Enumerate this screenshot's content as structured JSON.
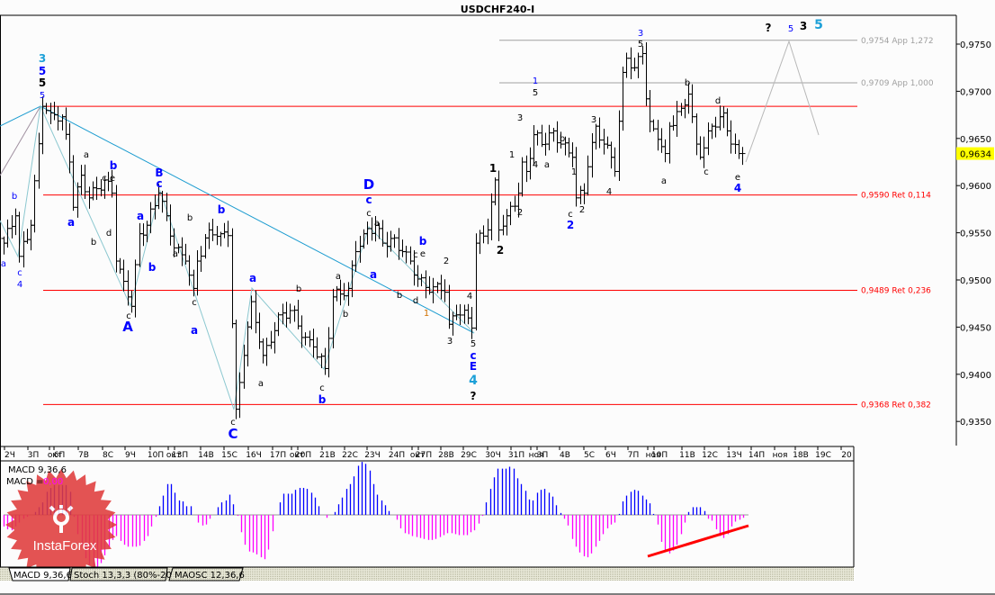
{
  "title": "USDCHF240-I",
  "chart_data": {
    "type": "ohlc",
    "symbol": "USDCHF240-I",
    "timeframe": "H4",
    "y_axis": {
      "range": [
        0.9325,
        0.978
      ],
      "ticks": [
        {
          "value": 0.975,
          "label": "0,9750"
        },
        {
          "value": 0.97,
          "label": "0,9700"
        },
        {
          "value": 0.965,
          "label": "0,9650"
        },
        {
          "value": 0.96,
          "label": "0,9600"
        },
        {
          "value": 0.955,
          "label": "0,9550"
        },
        {
          "value": 0.95,
          "label": "0,9500"
        },
        {
          "value": 0.945,
          "label": "0,9450"
        },
        {
          "value": 0.94,
          "label": "0,9400"
        },
        {
          "value": 0.935,
          "label": "0,9350"
        }
      ]
    },
    "x_axis": {
      "ticks": [
        "2Ч",
        "3П",
        "окт",
        "6П",
        "7В",
        "8С",
        "9Ч",
        "10П",
        "окт",
        "13П",
        "14В",
        "15С",
        "16Ч",
        "17П",
        "окт",
        "20П",
        "21В",
        "22С",
        "23Ч",
        "24П",
        "окт",
        "27П",
        "28В",
        "29С",
        "30Ч",
        "31П",
        "ноя",
        "3П",
        "4В",
        "5С",
        "6Ч",
        "7П",
        "ноя",
        "10П",
        "11В",
        "12С",
        "13Ч",
        "14П",
        "ноя",
        "18В",
        "19С",
        "20"
      ]
    },
    "current_price": {
      "value": 0.9634,
      "label": "0,9634",
      "color": "#ffff00"
    },
    "price_path": [
      {
        "bar": 0,
        "price": 0.9539
      },
      {
        "bar": 3,
        "price": 0.9568
      },
      {
        "bar": 4,
        "price": 0.9525
      },
      {
        "bar": 7,
        "price": 0.9558
      },
      {
        "bar": 10,
        "price": 0.9684
      },
      {
        "bar": 12,
        "price": 0.9677
      },
      {
        "bar": 15,
        "price": 0.9673
      },
      {
        "bar": 17,
        "price": 0.9625
      },
      {
        "bar": 18,
        "price": 0.9577
      },
      {
        "bar": 20,
        "price": 0.9611
      },
      {
        "bar": 22,
        "price": 0.9587
      },
      {
        "bar": 26,
        "price": 0.9606
      },
      {
        "bar": 28,
        "price": 0.9592
      },
      {
        "bar": 29,
        "price": 0.952
      },
      {
        "bar": 32,
        "price": 0.9482
      },
      {
        "bar": 33,
        "price": 0.9472
      },
      {
        "bar": 35,
        "price": 0.9549
      },
      {
        "bar": 37,
        "price": 0.9558
      },
      {
        "bar": 40,
        "price": 0.9592
      },
      {
        "bar": 42,
        "price": 0.9568
      },
      {
        "bar": 44,
        "price": 0.9534
      },
      {
        "bar": 47,
        "price": 0.952
      },
      {
        "bar": 49,
        "price": 0.9491
      },
      {
        "bar": 50,
        "price": 0.952
      },
      {
        "bar": 53,
        "price": 0.9553
      },
      {
        "bar": 56,
        "price": 0.9549
      },
      {
        "bar": 58,
        "price": 0.9547
      },
      {
        "bar": 60,
        "price": 0.9363
      },
      {
        "bar": 62,
        "price": 0.942
      },
      {
        "bar": 64,
        "price": 0.9477
      },
      {
        "bar": 67,
        "price": 0.942
      },
      {
        "bar": 69,
        "price": 0.9434
      },
      {
        "bar": 71,
        "price": 0.9463
      },
      {
        "bar": 75,
        "price": 0.9468
      },
      {
        "bar": 77,
        "price": 0.9439
      },
      {
        "bar": 80,
        "price": 0.9429
      },
      {
        "bar": 83,
        "price": 0.9406
      },
      {
        "bar": 85,
        "price": 0.9482
      },
      {
        "bar": 89,
        "price": 0.9491
      },
      {
        "bar": 91,
        "price": 0.953
      },
      {
        "bar": 93,
        "price": 0.9549
      },
      {
        "bar": 96,
        "price": 0.9558
      },
      {
        "bar": 98,
        "price": 0.9539
      },
      {
        "bar": 100,
        "price": 0.9544
      },
      {
        "bar": 103,
        "price": 0.953
      },
      {
        "bar": 105,
        "price": 0.952
      },
      {
        "bar": 107,
        "price": 0.9501
      },
      {
        "bar": 110,
        "price": 0.9487
      },
      {
        "bar": 112,
        "price": 0.9496
      },
      {
        "bar": 114,
        "price": 0.9487
      },
      {
        "bar": 115,
        "price": 0.9453
      },
      {
        "bar": 117,
        "price": 0.9463
      },
      {
        "bar": 119,
        "price": 0.9468
      },
      {
        "bar": 121,
        "price": 0.9449
      },
      {
        "bar": 122,
        "price": 0.9539
      },
      {
        "bar": 125,
        "price": 0.9553
      },
      {
        "bar": 127,
        "price": 0.9606
      },
      {
        "bar": 128,
        "price": 0.9553
      },
      {
        "bar": 130,
        "price": 0.9568
      },
      {
        "bar": 133,
        "price": 0.9592
      },
      {
        "bar": 134,
        "price": 0.9625
      },
      {
        "bar": 135,
        "price": 0.9615
      },
      {
        "bar": 137,
        "price": 0.9654
      },
      {
        "bar": 140,
        "price": 0.9644
      },
      {
        "bar": 142,
        "price": 0.9658
      },
      {
        "bar": 144,
        "price": 0.9644
      },
      {
        "bar": 147,
        "price": 0.963
      },
      {
        "bar": 148,
        "price": 0.9587
      },
      {
        "bar": 150,
        "price": 0.9592
      },
      {
        "bar": 151,
        "price": 0.962
      },
      {
        "bar": 153,
        "price": 0.9663
      },
      {
        "bar": 155,
        "price": 0.9644
      },
      {
        "bar": 157,
        "price": 0.963
      },
      {
        "bar": 158,
        "price": 0.9615
      },
      {
        "bar": 160,
        "price": 0.972
      },
      {
        "bar": 161,
        "price": 0.9735
      },
      {
        "bar": 163,
        "price": 0.9725
      },
      {
        "bar": 165,
        "price": 0.974
      },
      {
        "bar": 166,
        "price": 0.9692
      },
      {
        "bar": 167,
        "price": 0.9668
      },
      {
        "bar": 169,
        "price": 0.9649
      },
      {
        "bar": 171,
        "price": 0.9634
      },
      {
        "bar": 172,
        "price": 0.9663
      },
      {
        "bar": 175,
        "price": 0.9682
      },
      {
        "bar": 177,
        "price": 0.9697
      },
      {
        "bar": 178,
        "price": 0.9673
      },
      {
        "bar": 179,
        "price": 0.9644
      },
      {
        "bar": 180,
        "price": 0.963
      },
      {
        "bar": 183,
        "price": 0.9663
      },
      {
        "bar": 185,
        "price": 0.9673
      },
      {
        "bar": 186,
        "price": 0.9677
      },
      {
        "bar": 187,
        "price": 0.9658
      },
      {
        "bar": 188,
        "price": 0.9644
      },
      {
        "bar": 190,
        "price": 0.9634
      },
      {
        "bar": 191,
        "price": 0.9634
      }
    ],
    "levels": [
      {
        "price": 0.9754,
        "label": "0,9754 App 1,272",
        "color": "#a0a0a0"
      },
      {
        "price": 0.9709,
        "label": "0,9709 App 1,000",
        "color": "#a0a0a0"
      },
      {
        "price": 0.9684,
        "label": "",
        "color": "#ff0000"
      },
      {
        "price": 0.959,
        "label": "0,9590 Ret 0,114",
        "color": "#ff0000"
      },
      {
        "price": 0.9489,
        "label": "0,9489 Ret 0,236",
        "color": "#ff0000"
      },
      {
        "price": 0.9368,
        "label": "0,9368 Ret 0,382",
        "color": "#ff0000"
      }
    ],
    "trendline_color": "#1c9cd0",
    "wave_line_color": "#8cc8d0",
    "wave_labels": [
      {
        "text": "3",
        "color": "#1ca0d8"
      },
      {
        "text": "5",
        "color": "#0000ff"
      },
      {
        "text": "5",
        "color": "#000000"
      },
      {
        "text": "5",
        "color": "#0000ff"
      },
      {
        "text": "b",
        "color": "#0000ff"
      },
      {
        "text": "a",
        "color": "#0000ff"
      },
      {
        "text": "c",
        "color": "#0000ff"
      },
      {
        "text": "4",
        "color": "#0000ff"
      },
      {
        "text": "a",
        "color": "#000000"
      },
      {
        "text": "b",
        "color": "#0000ff"
      },
      {
        "text": "c",
        "color": "#000000"
      },
      {
        "text": "e",
        "color": "#000000"
      },
      {
        "text": "a",
        "color": "#0000ff"
      },
      {
        "text": "b",
        "color": "#000000"
      },
      {
        "text": "d",
        "color": "#000000"
      },
      {
        "text": "c",
        "color": "#000000"
      },
      {
        "text": "A",
        "color": "#0000ff"
      },
      {
        "text": "B",
        "color": "#0000ff"
      },
      {
        "text": "c",
        "color": "#0000ff"
      },
      {
        "text": "a",
        "color": "#0000ff"
      },
      {
        "text": "b",
        "color": "#0000ff"
      },
      {
        "text": "a",
        "color": "#000000"
      },
      {
        "text": "b",
        "color": "#000000"
      },
      {
        "text": "c",
        "color": "#000000"
      },
      {
        "text": "a",
        "color": "#0000ff"
      },
      {
        "text": "b",
        "color": "#0000ff"
      },
      {
        "text": "c",
        "color": "#000000"
      },
      {
        "text": "C",
        "color": "#0000ff"
      },
      {
        "text": "a",
        "color": "#0000ff"
      },
      {
        "text": "b",
        "color": "#000000"
      },
      {
        "text": "a",
        "color": "#000000"
      },
      {
        "text": "c",
        "color": "#000000"
      },
      {
        "text": "b",
        "color": "#0000ff"
      },
      {
        "text": "a",
        "color": "#000000"
      },
      {
        "text": "b",
        "color": "#000000"
      },
      {
        "text": "D",
        "color": "#0000ff"
      },
      {
        "text": "c",
        "color": "#0000ff"
      },
      {
        "text": "c",
        "color": "#000000"
      },
      {
        "text": "a",
        "color": "#000000"
      },
      {
        "text": "a",
        "color": "#0000ff"
      },
      {
        "text": "b",
        "color": "#000000"
      },
      {
        "text": "d",
        "color": "#000000"
      },
      {
        "text": "b",
        "color": "#0000ff"
      },
      {
        "text": "c",
        "color": "#000000"
      },
      {
        "text": "e",
        "color": "#000000"
      },
      {
        "text": "1",
        "color": "#d07000"
      },
      {
        "text": "2",
        "color": "#000000"
      },
      {
        "text": "3",
        "color": "#000000"
      },
      {
        "text": "4",
        "color": "#000000"
      },
      {
        "text": "5",
        "color": "#000000"
      },
      {
        "text": "c",
        "color": "#0000ff"
      },
      {
        "text": "E",
        "color": "#0000ff"
      },
      {
        "text": "4",
        "color": "#1ca0d8"
      },
      {
        "text": "?",
        "color": "#000000"
      },
      {
        "text": "1",
        "color": "#000000"
      },
      {
        "text": "2",
        "color": "#000000"
      },
      {
        "text": "1",
        "color": "#000000"
      },
      {
        "text": "3",
        "color": "#000000"
      },
      {
        "text": "2",
        "color": "#000000"
      },
      {
        "text": "1",
        "color": "#0000ff"
      },
      {
        "text": "5",
        "color": "#000000"
      },
      {
        "text": "4",
        "color": "#000000"
      },
      {
        "text": "a",
        "color": "#000000"
      },
      {
        "text": "b",
        "color": "#000000"
      },
      {
        "text": "1",
        "color": "#000000"
      },
      {
        "text": "c",
        "color": "#000000"
      },
      {
        "text": "2",
        "color": "#0000ff"
      },
      {
        "text": "2",
        "color": "#000000"
      },
      {
        "text": "3",
        "color": "#000000"
      },
      {
        "text": "4",
        "color": "#000000"
      },
      {
        "text": "3",
        "color": "#0000ff"
      },
      {
        "text": "5",
        "color": "#000000"
      },
      {
        "text": "a",
        "color": "#000000"
      },
      {
        "text": "b",
        "color": "#000000"
      },
      {
        "text": "c",
        "color": "#000000"
      },
      {
        "text": "d",
        "color": "#000000"
      },
      {
        "text": "e",
        "color": "#000000"
      },
      {
        "text": "4",
        "color": "#0000ff"
      },
      {
        "text": "?",
        "color": "#000000"
      },
      {
        "text": "5",
        "color": "#0000ff"
      },
      {
        "text": "3",
        "color": "#000000"
      },
      {
        "text": "5",
        "color": "#1ca0d8"
      }
    ],
    "macd": {
      "title": "MACD 9,36,6",
      "value_label": "MACD =",
      "value": "0,00",
      "value_color": "#ff00ff",
      "pos_color": "#0000ff",
      "neg_color": "#ff00ff",
      "divergence_line_color": "#ff0000",
      "histogram": [
        -12,
        -15,
        -16,
        -12,
        -8,
        -4,
        -2,
        0,
        3,
        8,
        13,
        24,
        28,
        31,
        31,
        31,
        31,
        24,
        -2,
        -20,
        -33,
        -45,
        -52,
        -55,
        -56,
        -50,
        -42,
        -34,
        -26,
        -22,
        -27,
        -31,
        -33,
        -33,
        -33,
        -32,
        -27,
        -22,
        -12,
        -2,
        9,
        20,
        32,
        32,
        23,
        15,
        14,
        9,
        9,
        0,
        -8,
        -11,
        -10,
        -4,
        0,
        8,
        13,
        15,
        21,
        11,
        -1,
        -18,
        -31,
        -38,
        -39,
        -41,
        -44,
        -46,
        -36,
        -17,
        0,
        13,
        22,
        22,
        22,
        26,
        28,
        28,
        27,
        23,
        18,
        9,
        0,
        -3,
        0,
        3,
        11,
        18,
        27,
        32,
        40,
        51,
        55,
        53,
        46,
        32,
        21,
        15,
        10,
        4,
        0,
        -5,
        -14,
        -19,
        -20,
        -22,
        -23,
        -24,
        -25,
        -26,
        -26,
        -25,
        -23,
        -21,
        -19,
        -19,
        -20,
        -21,
        -21,
        -21,
        -18,
        -16,
        -9,
        -1,
        13,
        27,
        39,
        48,
        48,
        48,
        50,
        48,
        38,
        32,
        25,
        16,
        15,
        23,
        26,
        27,
        23,
        19,
        10,
        2,
        -4,
        -11,
        -25,
        -33,
        -39,
        -43,
        -44,
        -40,
        -33,
        -27,
        -20,
        -14,
        -10,
        -8,
        1,
        14,
        20,
        24,
        26,
        25,
        20,
        16,
        12,
        1,
        -10,
        -28,
        -38,
        -40,
        -37,
        -31,
        -20,
        -8,
        3,
        8,
        8,
        8,
        4,
        -4,
        -6,
        -15,
        -22,
        -24,
        -20,
        -12,
        -7,
        -5,
        -3
      ]
    }
  },
  "tabs": [
    {
      "label": "MACD 9,36,6",
      "active": true
    },
    {
      "label": "Stoch 13,3,3 (80%-20%)",
      "active": false
    },
    {
      "label": "MAOSC 12,36,6",
      "active": false
    }
  ],
  "watermark": {
    "text": "InstaForex",
    "color": "#e03c3c"
  }
}
